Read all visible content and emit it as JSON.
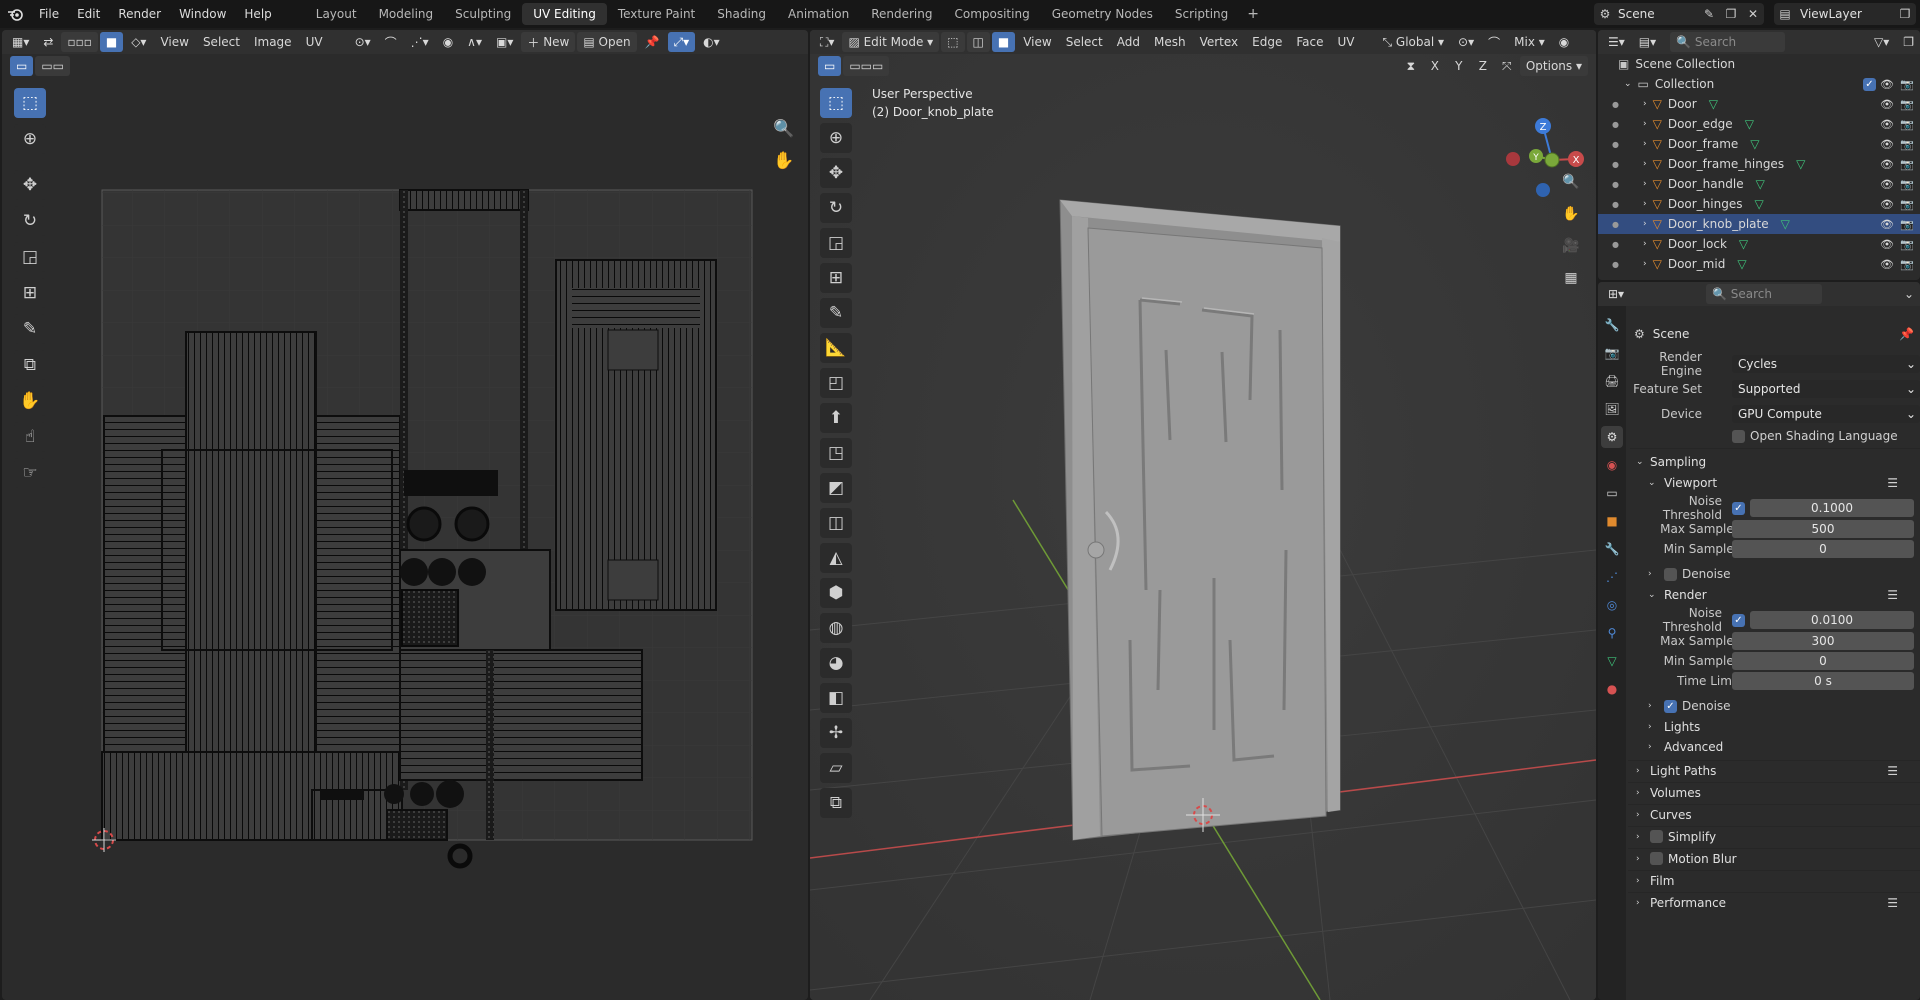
{
  "menu": {
    "items": [
      "File",
      "Edit",
      "Render",
      "Window",
      "Help"
    ]
  },
  "workspaces": {
    "tabs": [
      "Layout",
      "Modeling",
      "Sculpting",
      "UV Editing",
      "Texture Paint",
      "Shading",
      "Animation",
      "Rendering",
      "Compositing",
      "Geometry Nodes",
      "Scripting"
    ],
    "active": "UV Editing"
  },
  "scene": {
    "name": "Scene",
    "view_layer": "ViewLayer"
  },
  "uv_editor": {
    "menus": [
      "View",
      "Select",
      "Image",
      "UV"
    ],
    "new_label": "New",
    "open_label": "Open"
  },
  "viewport": {
    "mode": "Edit Mode",
    "menus": [
      "View",
      "Select",
      "Add",
      "Mesh",
      "Vertex",
      "Edge",
      "Face",
      "UV"
    ],
    "orientation": "Global",
    "shading": "Mix",
    "options_label": "Options",
    "perspective": "User Perspective",
    "object_label": "(2) Door_knob_plate",
    "axes": {
      "x": "X",
      "y": "Y",
      "z": "Z"
    }
  },
  "outliner": {
    "search_placeholder": "Search",
    "scene_collection": "Scene Collection",
    "collection": "Collection",
    "items": [
      {
        "name": "Door",
        "selected": false
      },
      {
        "name": "Door_edge",
        "selected": false
      },
      {
        "name": "Door_frame",
        "selected": false
      },
      {
        "name": "Door_frame_hinges",
        "selected": false
      },
      {
        "name": "Door_handle",
        "selected": false
      },
      {
        "name": "Door_hinges",
        "selected": false
      },
      {
        "name": "Door_knob_plate",
        "selected": true
      },
      {
        "name": "Door_lock",
        "selected": false
      },
      {
        "name": "Door_mid",
        "selected": false
      }
    ]
  },
  "properties": {
    "search_placeholder": "Search",
    "context": "Scene",
    "render_engine_label": "Render Engine",
    "render_engine": "Cycles",
    "feature_set_label": "Feature Set",
    "feature_set": "Supported",
    "device_label": "Device",
    "device": "GPU Compute",
    "osl_label": "Open Shading Language",
    "sampling": "Sampling",
    "viewport": {
      "title": "Viewport",
      "noise_threshold_label": "Noise Threshold",
      "noise_threshold": "0.1000",
      "max_samples_label": "Max Samples",
      "max_samples": "500",
      "min_samples_label": "Min Samples",
      "min_samples": "0",
      "denoise_label": "Denoise"
    },
    "render": {
      "title": "Render",
      "noise_threshold_label": "Noise Threshold",
      "noise_threshold": "0.0100",
      "max_samples_label": "Max Samples",
      "max_samples": "300",
      "min_samples_label": "Min Samples",
      "min_samples": "0",
      "time_limit_label": "Time Limit",
      "time_limit": "0 s",
      "denoise_label": "Denoise"
    },
    "lights": "Lights",
    "advanced": "Advanced",
    "sections": [
      "Light Paths",
      "Volumes",
      "Curves",
      "Simplify",
      "Motion Blur",
      "Film",
      "Performance"
    ]
  },
  "colors": {
    "accent": "#4772b3",
    "selected_row": "#334d80",
    "bg": "#2e2e2e",
    "x_axis": "#c84b4b",
    "y_axis": "#7aa83a",
    "z_axis": "#3d7bd9"
  }
}
